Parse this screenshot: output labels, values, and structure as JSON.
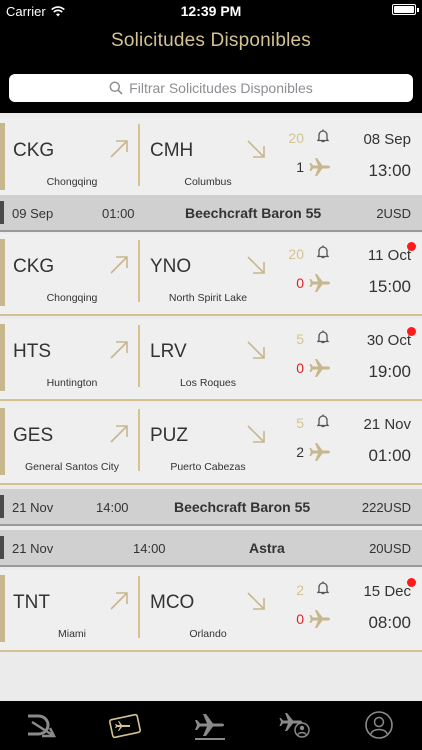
{
  "status_bar": {
    "carrier": "Carrier",
    "time": "12:39 PM"
  },
  "header": {
    "title": "Solicitudes Disponibles"
  },
  "search": {
    "placeholder": "Filtrar Solicitudes Disponibles"
  },
  "requests": [
    {
      "origin": "CKG",
      "origin_city": "Chongqing",
      "dest": "CMH",
      "dest_city": "Columbus",
      "count_top": "20",
      "count_bottom": "1",
      "count_bottom_color": "#333333",
      "date": "08 Sep",
      "time": "13:00",
      "new": false
    },
    {
      "origin": "CKG",
      "origin_city": "Chongqing",
      "dest": "YNO",
      "dest_city": "North Spirit Lake",
      "count_top": "20",
      "count_bottom": "0",
      "count_bottom_color": "#e02020",
      "date": "11 Oct",
      "time": "15:00",
      "new": true
    },
    {
      "origin": "HTS",
      "origin_city": "Huntington",
      "dest": "LRV",
      "dest_city": "Los Roques",
      "count_top": "5",
      "count_bottom": "0",
      "count_bottom_color": "#e02020",
      "date": "30 Oct",
      "time": "19:00",
      "new": true
    },
    {
      "origin": "GES",
      "origin_city": "General Santos City",
      "dest": "PUZ",
      "dest_city": "Puerto Cabezas",
      "count_top": "5",
      "count_bottom": "2",
      "count_bottom_color": "#333333",
      "date": "21 Nov",
      "time": "01:00",
      "new": false
    },
    {
      "origin": "TNT",
      "origin_city": "Miami",
      "dest": "MCO",
      "dest_city": "Orlando",
      "count_top": "2",
      "count_bottom": "0",
      "count_bottom_color": "#e02020",
      "date": "15 Dec",
      "time": "08:00",
      "new": true
    }
  ],
  "bands": [
    {
      "date": "09 Sep",
      "time": "01:00",
      "aircraft": "Beechcraft Baron 55",
      "price": "2USD"
    },
    {
      "date": "21 Nov",
      "time": "14:00",
      "aircraft": "Beechcraft Baron 55",
      "price": "222USD"
    },
    {
      "date": "21 Nov",
      "time": "14:00",
      "aircraft": "Astra",
      "price": "20USD"
    }
  ],
  "tabs": [
    {
      "name": "logo-tab",
      "icon": "logo-icon",
      "active": false
    },
    {
      "name": "tickets-tab",
      "icon": "ticket-icon",
      "active": false
    },
    {
      "name": "flights-tab",
      "icon": "plane-icon",
      "active": true
    },
    {
      "name": "my-flights-tab",
      "icon": "plane-user-icon",
      "active": false
    },
    {
      "name": "profile-tab",
      "icon": "profile-icon",
      "active": false
    }
  ],
  "colors": {
    "accent": "#d4c391",
    "header_bg": "#000000",
    "alert": "#e02020"
  }
}
